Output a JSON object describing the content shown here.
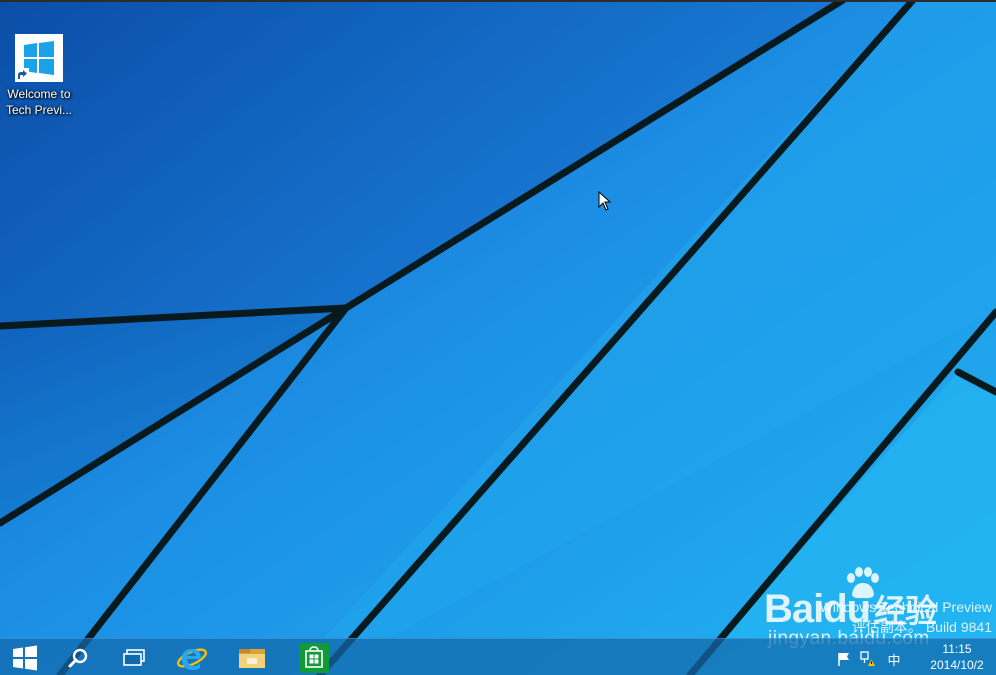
{
  "desktop": {
    "icons": [
      {
        "label": "Welcome to\nTech Previ...",
        "icon": "windows-logo-icon"
      }
    ]
  },
  "watermark": {
    "line1": "Windows Technical Preview",
    "line2": "评估副本。 Build 9841"
  },
  "overlay_logo": {
    "brand": "Bai",
    "brand_suffix": "du",
    "brand_cn": "经验",
    "domain": "jingyan.baidu.com"
  },
  "taskbar": {
    "buttons": [
      {
        "name": "start-button",
        "icon": "windows-logo-icon"
      },
      {
        "name": "search-button",
        "icon": "search-icon"
      },
      {
        "name": "task-view-button",
        "icon": "task-view-icon"
      },
      {
        "name": "internet-explorer-button",
        "icon": "internet-explorer-icon"
      },
      {
        "name": "file-explorer-button",
        "icon": "folder-icon"
      },
      {
        "name": "store-button",
        "icon": "store-icon"
      }
    ],
    "tray": {
      "ime": "中",
      "time": "11:15",
      "date": "2014/10/2"
    }
  },
  "colors": {
    "wallpaper_dark": "#0a4fa8",
    "wallpaper_mid": "#1a8be0",
    "wallpaper_light": "#22b2f0",
    "taskbar": "#1268aa"
  }
}
